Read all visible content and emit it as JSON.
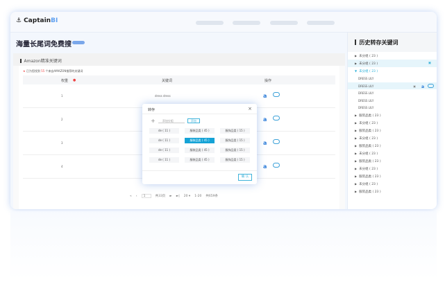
{
  "app": {
    "logo_main": "Captain",
    "logo_accent": "BI"
  },
  "page_title": "海量长尾词免费搜",
  "section_title": "Amazon精准关键词",
  "note": {
    "prefix": "已为您找到",
    "count": "55",
    "suffix": "个来自AMAZON推荐的关键词"
  },
  "table": {
    "headers": [
      "权重",
      "关键词",
      "操作"
    ],
    "rows": [
      {
        "rank": "1",
        "keyword": "dress dress"
      },
      {
        "rank": "2",
        "keyword": ""
      },
      {
        "rank": "3",
        "keyword": ""
      },
      {
        "rank": "4",
        "keyword": ""
      }
    ]
  },
  "pagination": {
    "first": "«",
    "prev": "‹",
    "page": "1",
    "total_pages": "共33页",
    "next": "►",
    "last": "►|",
    "page_size": "20 ▾",
    "range": "1-20",
    "total": "共659条"
  },
  "sidebar": {
    "title": "历史转存关键词",
    "groups_top": [
      {
        "label": "未分组 ( 23 )"
      },
      {
        "label": "未分组 ( 23 )",
        "selected": true
      },
      {
        "label": "未分组 ( 23 )",
        "open": true
      }
    ],
    "keywords": [
      "DRESS LILY",
      "DRESS LILY",
      "DRESS LILY",
      "DRESS LILY",
      "DRESS LILY"
    ],
    "groups_bottom": [
      "服装品类 ( 23 )",
      "未分组 ( 23 )",
      "服装品类 ( 23 )",
      "未分组 ( 23 )",
      "服装品类 ( 23 )",
      "未分组 ( 23 )",
      "服装品类 ( 23 )",
      "未分组 ( 23 )",
      "服装品类 ( 23 )",
      "未分组 ( 23 )",
      "服装品类 ( 23 )"
    ]
  },
  "modal": {
    "title": "转存",
    "close": "×",
    "input_placeholder": "添加分组",
    "add_label": "添加",
    "tags": [
      "de ( 11 )",
      "服装品类 ( 45 )",
      "服饰品类 ( 15 )",
      "de ( 11 )",
      "服装品类 ( 45 )",
      "服饰品类 ( 15 )",
      "de ( 11 )",
      "服装品类 ( 45 )",
      "服饰品类 ( 15 )",
      "de ( 11 )",
      "服装品类 ( 45 )",
      "服饰品类 ( 15 )"
    ],
    "selected_index": 4,
    "confirm": "确 认"
  }
}
